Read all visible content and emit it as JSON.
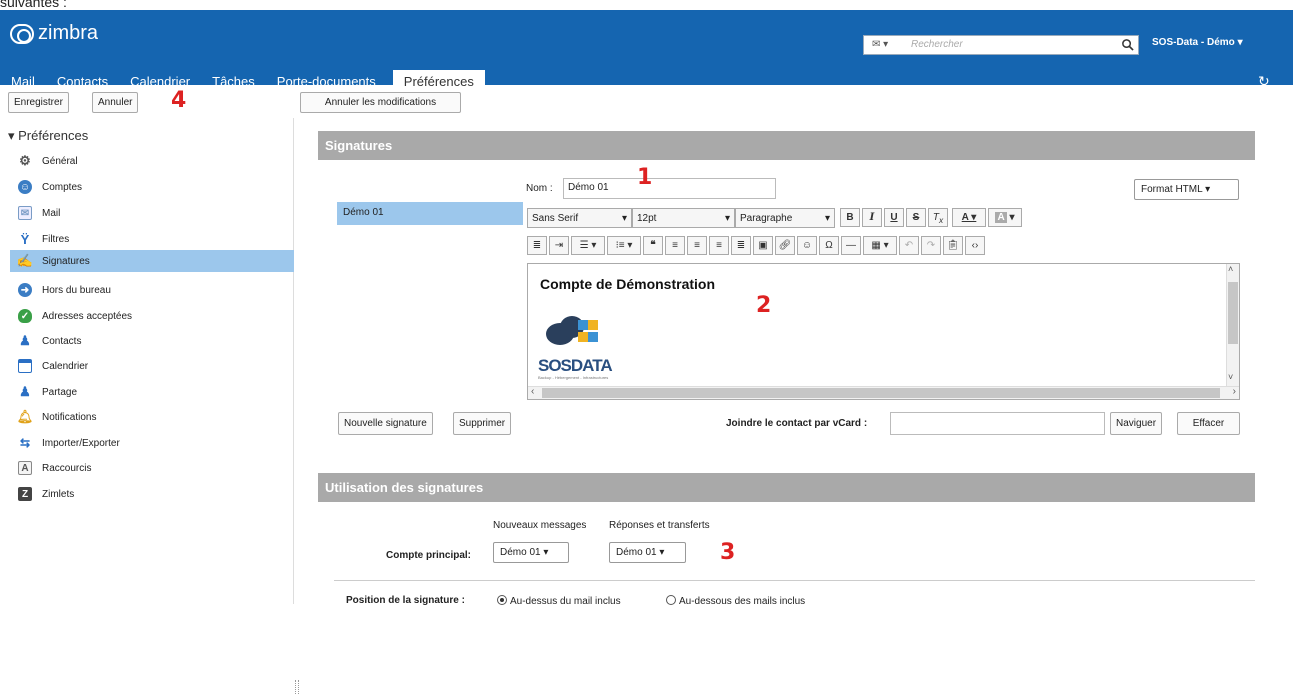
{
  "top_fragment": "suivantes :",
  "header": {
    "logo": "zimbra",
    "search_option": "▾",
    "search_placeholder": "Rechercher",
    "user": "SOS-Data - Démo ▾",
    "refresh": "↻"
  },
  "tabs": [
    "Mail",
    "Contacts",
    "Calendrier",
    "Tâches",
    "Porte-documents",
    "Préférences"
  ],
  "toolbar": {
    "save": "Enregistrer",
    "cancel": "Annuler",
    "undo_changes": "Annuler les modifications"
  },
  "annotations": [
    "1",
    "2",
    "3",
    "4"
  ],
  "sidebar": {
    "title": "▾ Préférences",
    "items": [
      "Général",
      "Comptes",
      "Mail",
      "Filtres",
      "Signatures",
      "Hors du bureau",
      "Adresses acceptées",
      "Contacts",
      "Calendrier",
      "Partage",
      "Notifications",
      "Importer/Exporter",
      "Raccourcis",
      "Zimlets"
    ]
  },
  "signatures": {
    "section_title": "Signatures",
    "name_label": "Nom :",
    "name_value": "Démo 01",
    "format": "Format HTML ▾",
    "list_item": "Démo 01",
    "toolbar": {
      "font": "Sans Serif",
      "size": "12pt",
      "block": "Paragraphe"
    },
    "editor_heading": "Compte de Démonstration",
    "logo_text": "SOSDATA",
    "logo_sub": "Backup - Hébergement - Infrastructures",
    "new_button": "Nouvelle signature",
    "delete_button": "Supprimer",
    "vcard_label": "Joindre le contact par vCard :",
    "browse": "Naviguer",
    "clear": "Effacer"
  },
  "usage": {
    "section_title": "Utilisation des signatures",
    "col_new": "Nouveaux messages",
    "col_replies": "Réponses et transferts",
    "row_label": "Compte principal:",
    "new_value": "Démo 01 ▾",
    "reply_value": "Démo 01 ▾",
    "position_label": "Position de la signature :",
    "opt_above": "Au-dessus du mail inclus",
    "opt_below": "Au-dessous des mails inclus"
  }
}
